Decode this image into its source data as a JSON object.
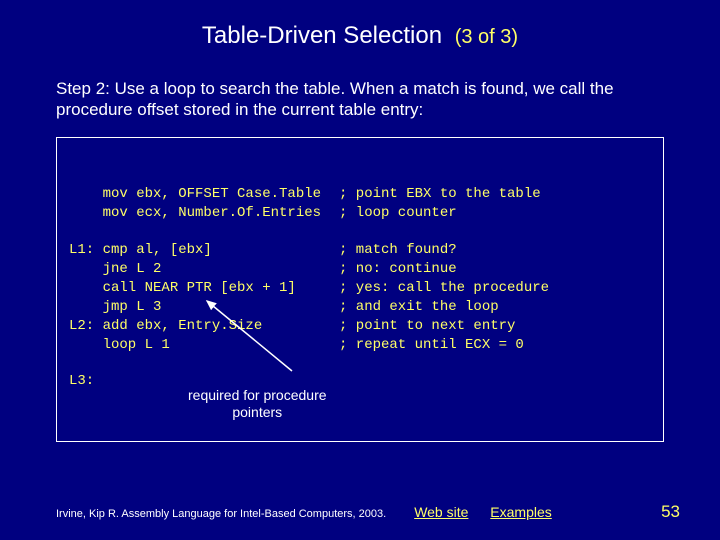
{
  "title": {
    "main": "Table-Driven Selection",
    "sub": "(3 of 3)"
  },
  "step": "Step 2: Use a loop to search the table. When a match is found, we call the procedure offset stored in the current table entry:",
  "code": {
    "rows": [
      {
        "left": "    mov ebx, OFFSET Case.Table",
        "right": "; point EBX to the table"
      },
      {
        "left": "    mov ecx, Number.Of.Entries",
        "right": "; loop counter"
      },
      {
        "blank": true
      },
      {
        "left": "L1: cmp al, [ebx]",
        "right": "; match found?"
      },
      {
        "left": "    jne L 2",
        "right": "; no: continue"
      },
      {
        "left": "    call NEAR PTR [ebx + 1]",
        "right": "; yes: call the procedure"
      },
      {
        "left": "    jmp L 3",
        "right": "; and exit the loop"
      },
      {
        "left": "L2: add ebx, Entry.Size",
        "right": "; point to next entry"
      },
      {
        "left": "    loop L 1",
        "right": "; repeat until ECX = 0"
      },
      {
        "blank": true
      },
      {
        "left": "L3:",
        "right": ""
      }
    ]
  },
  "caption": {
    "line1": "required for procedure",
    "line2": "pointers"
  },
  "footer": {
    "credit": "Irvine, Kip R. Assembly Language for Intel-Based Computers, 2003.",
    "link1": "Web site",
    "link2": "Examples",
    "pagenum": "53"
  }
}
